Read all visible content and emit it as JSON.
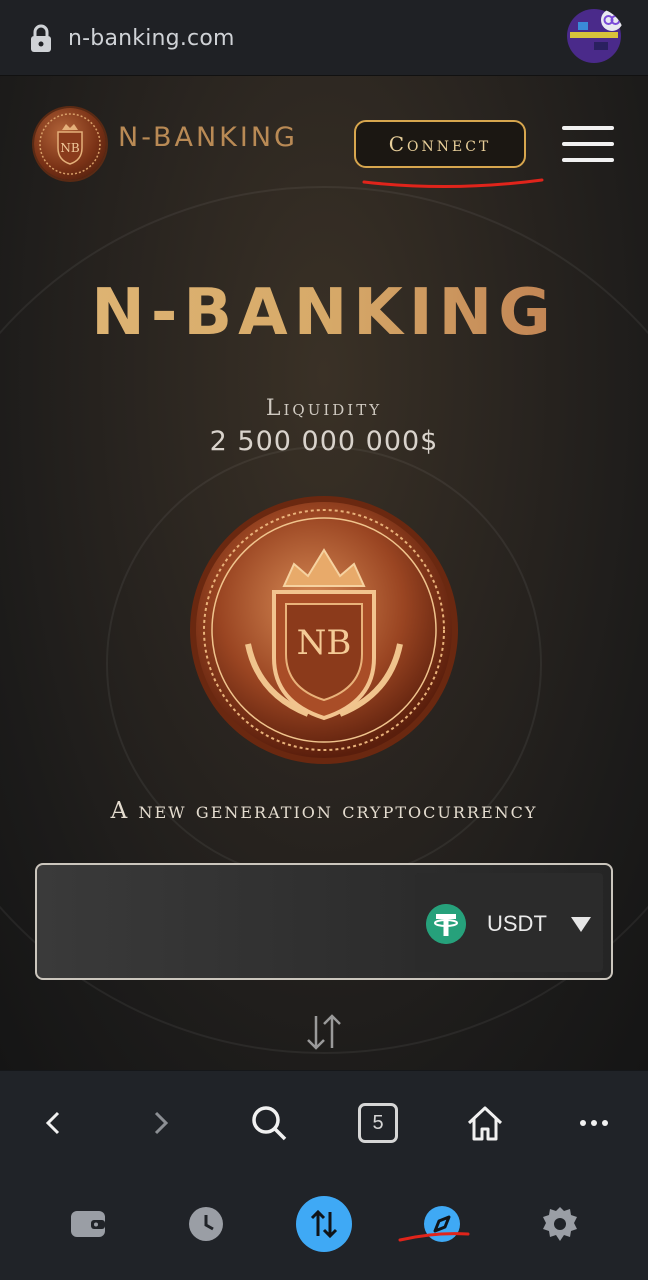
{
  "browser": {
    "url": "n-banking.com",
    "lock_icon": "lock-icon",
    "tab_count": "5"
  },
  "header": {
    "brand": "N-BANKING",
    "connect_label": "Connect",
    "menu_icon": "hamburger-menu-icon"
  },
  "hero": {
    "title": "N-BANKING",
    "liquidity_label": "Liquidity",
    "liquidity_value": "2 500 000 000$",
    "coin_letters": "NB",
    "tagline": "A new generation cryptocurrency"
  },
  "swap": {
    "token_symbol": "USDT",
    "token_icon": "tether-icon",
    "swap_direction_icon": "swap-vertical-icon"
  },
  "toolbar": {
    "icons": [
      "back-icon",
      "forward-icon",
      "search-icon",
      "tabs-icon",
      "home-icon",
      "more-icon"
    ]
  },
  "bottom_nav": {
    "icons": [
      "wallet-icon",
      "history-icon",
      "swap-icon",
      "discover-icon",
      "settings-icon"
    ],
    "active": "swap-icon",
    "accent": "#3fa9f5"
  },
  "colors": {
    "gold": "#d7a64e",
    "annotation_red": "#e0241b"
  }
}
